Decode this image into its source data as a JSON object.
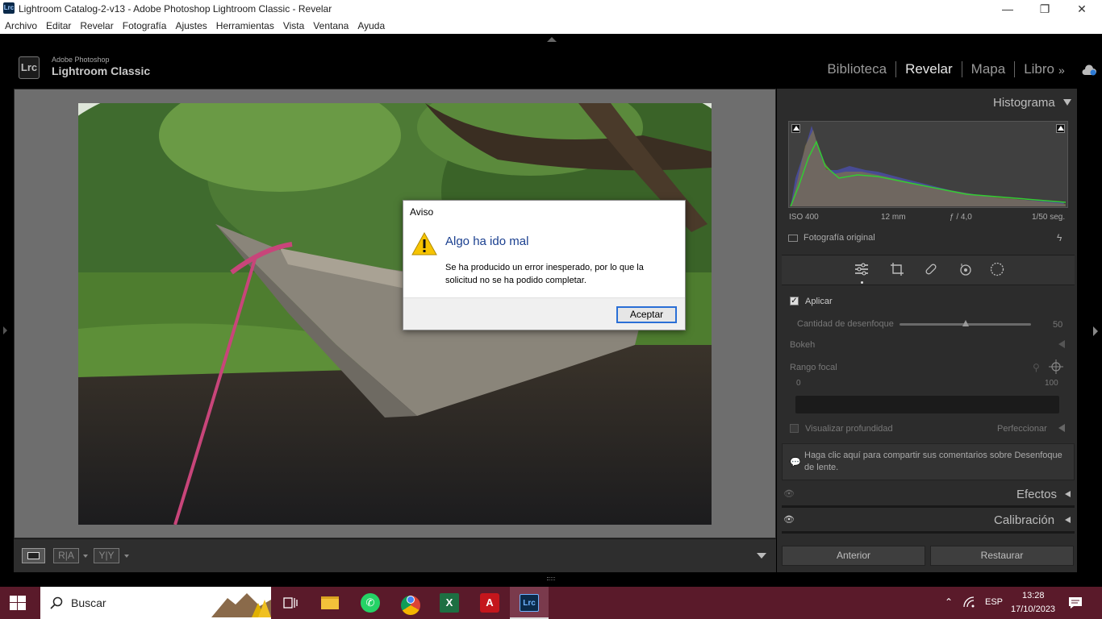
{
  "window": {
    "title": "Lightroom Catalog-2-v13 - Adobe Photoshop Lightroom Classic - Revelar",
    "logo_text": "Lrc",
    "minimize_glyph": "—",
    "restore_glyph": "❐",
    "close_glyph": "✕"
  },
  "menu": [
    "Archivo",
    "Editar",
    "Revelar",
    "Fotografía",
    "Ajustes",
    "Herramientas",
    "Vista",
    "Ventana",
    "Ayuda"
  ],
  "brand": {
    "badge": "Lrc",
    "line1": "Adobe Photoshop",
    "line2": "Lightroom Classic"
  },
  "modules": {
    "items": [
      "Biblioteca",
      "Revelar",
      "Mapa",
      "Libro"
    ],
    "active": "Revelar",
    "more_glyph": "»"
  },
  "histogram": {
    "title": "Histograma",
    "iso": "ISO 400",
    "focal": "12 mm",
    "aperture": "ƒ / 4,0",
    "shutter": "1/50 seg.",
    "original_label": "Fotografía original"
  },
  "lens_blur": {
    "apply_label": "Aplicar",
    "amount_label": "Cantidad de desenfoque",
    "amount_value": "50",
    "amount_fraction": 0.5,
    "bokeh_label": "Bokeh",
    "focal_range_label": "Rango focal",
    "range_min": "0",
    "range_max": "100",
    "visualize_label": "Visualizar profundidad",
    "refine_label": "Perfeccionar",
    "feedback_text": "Haga clic aquí para compartir sus comentarios sobre Desenfoque de lente."
  },
  "sections": {
    "effects": "Efectos",
    "calibration": "Calibración"
  },
  "buttons": {
    "previous": "Anterior",
    "reset": "Restaurar"
  },
  "filmstrip": {
    "ra_label": "R|A",
    "yy_label": "Y|Y"
  },
  "dialog": {
    "title": "Aviso",
    "heading": "Algo ha ido mal",
    "message": "Se ha producido un error inesperado, por lo que la solicitud no se ha podido completar.",
    "ok_label": "Aceptar"
  },
  "taskbar": {
    "search_label": "Buscar",
    "language": "ESP",
    "time": "13:28",
    "date": "17/10/2023"
  },
  "colors": {
    "workspace_gray": "#6e6e6e",
    "panel_bg": "#2c2c2c",
    "taskbar": "#5a1a2a",
    "dialog_heading": "#1a3f8f"
  }
}
